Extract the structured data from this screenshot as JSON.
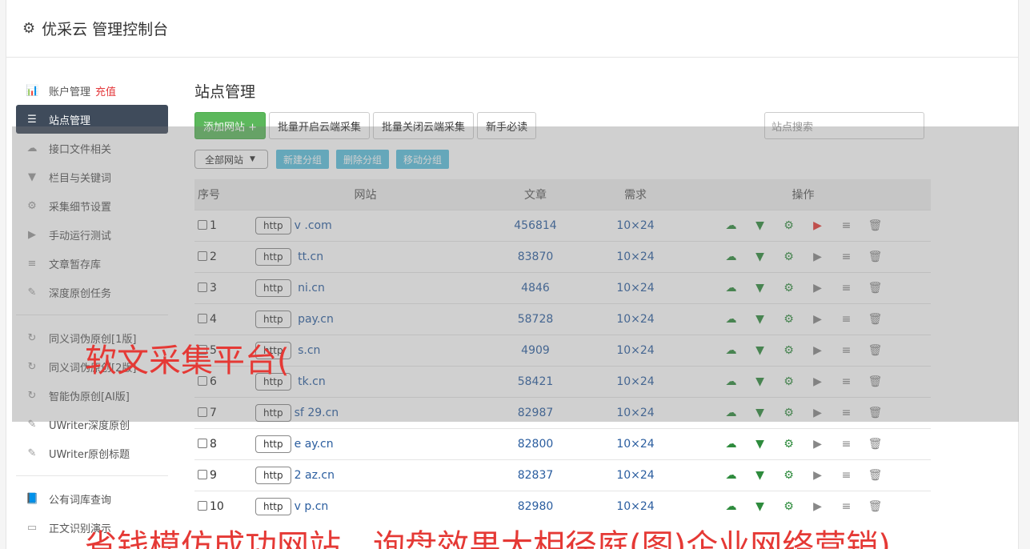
{
  "header": {
    "title": "优采云 管理控制台",
    "icon": "gear-icon"
  },
  "sidebar": {
    "items": [
      {
        "label": "账户管理",
        "extra": "充值",
        "icon": "bar-chart-icon",
        "active": false
      },
      {
        "label": "站点管理",
        "icon": "server-icon",
        "active": true
      },
      {
        "label": "接口文件相关",
        "icon": "cloud-upload-icon",
        "active": false
      },
      {
        "label": "栏目与关键词",
        "icon": "filter-icon",
        "active": false
      },
      {
        "label": "采集细节设置",
        "icon": "cogs-icon",
        "active": false
      },
      {
        "label": "手动运行测试",
        "icon": "play-circle-icon",
        "active": false
      },
      {
        "label": "文章暂存库",
        "icon": "database-icon",
        "active": false
      },
      {
        "label": "深度原创任务",
        "icon": "edit-icon",
        "active": false
      }
    ],
    "items2": [
      {
        "label": "同义词伪原创[1版]",
        "icon": "refresh-icon"
      },
      {
        "label": "同义词伪原创[2版]",
        "icon": "refresh-icon"
      },
      {
        "label": "智能伪原创[AI版]",
        "icon": "refresh-icon"
      },
      {
        "label": "UWriter深度原创",
        "icon": "edit-icon"
      },
      {
        "label": "UWriter原创标题",
        "icon": "edit-icon"
      }
    ],
    "items3": [
      {
        "label": "公有词库查询",
        "icon": "book-icon"
      },
      {
        "label": "正文识别演示",
        "icon": "monitor-icon"
      }
    ]
  },
  "main": {
    "title": "站点管理",
    "toolbar": {
      "add_site": "添加网站 +",
      "batch_open": "批量开启云端采集",
      "batch_close": "批量关闭云端采集",
      "guide": "新手必读",
      "search_placeholder": "站点搜索"
    },
    "filter": {
      "select_value": "全部网站",
      "new_group": "新建分组",
      "delete_group": "删除分组",
      "move_group": "移动分组"
    },
    "table": {
      "headers": [
        "序号",
        "网站",
        "文章",
        "需求",
        "操作"
      ],
      "rows": [
        {
          "no": "1",
          "proto": "http",
          "site": "v          .com",
          "articles": "456814",
          "need": "10×24",
          "running": true
        },
        {
          "no": "2",
          "proto": "http",
          "site": "     tt.cn",
          "articles": "83870",
          "need": "10×24",
          "running": false
        },
        {
          "no": "3",
          "proto": "http",
          "site": "      ni.cn",
          "articles": "4846",
          "need": "10×24",
          "running": false
        },
        {
          "no": "4",
          "proto": "http",
          "site": "      pay.cn",
          "articles": "58728",
          "need": "10×24",
          "running": false
        },
        {
          "no": "5",
          "proto": "http",
          "site": "        s.cn",
          "articles": "4909",
          "need": "10×24",
          "running": false
        },
        {
          "no": "6",
          "proto": "http",
          "site": "     tk.cn",
          "articles": "58421",
          "need": "10×24",
          "running": false
        },
        {
          "no": "7",
          "proto": "http",
          "site": "sf  29.cn",
          "articles": "82987",
          "need": "10×24",
          "running": false
        },
        {
          "no": "8",
          "proto": "http",
          "site": "e     ay.cn",
          "articles": "82800",
          "need": "10×24",
          "running": false
        },
        {
          "no": "9",
          "proto": "http",
          "site": "2     az.cn",
          "articles": "82837",
          "need": "10×24",
          "running": false
        },
        {
          "no": "10",
          "proto": "http",
          "site": "v     p.cn",
          "articles": "82980",
          "need": "10×24",
          "running": false
        }
      ]
    }
  },
  "watermark": {
    "line1": "软文采集平台(",
    "line2": "省钱模仿成功网站，询盘效果大相径庭(图)企业网络营销)"
  }
}
